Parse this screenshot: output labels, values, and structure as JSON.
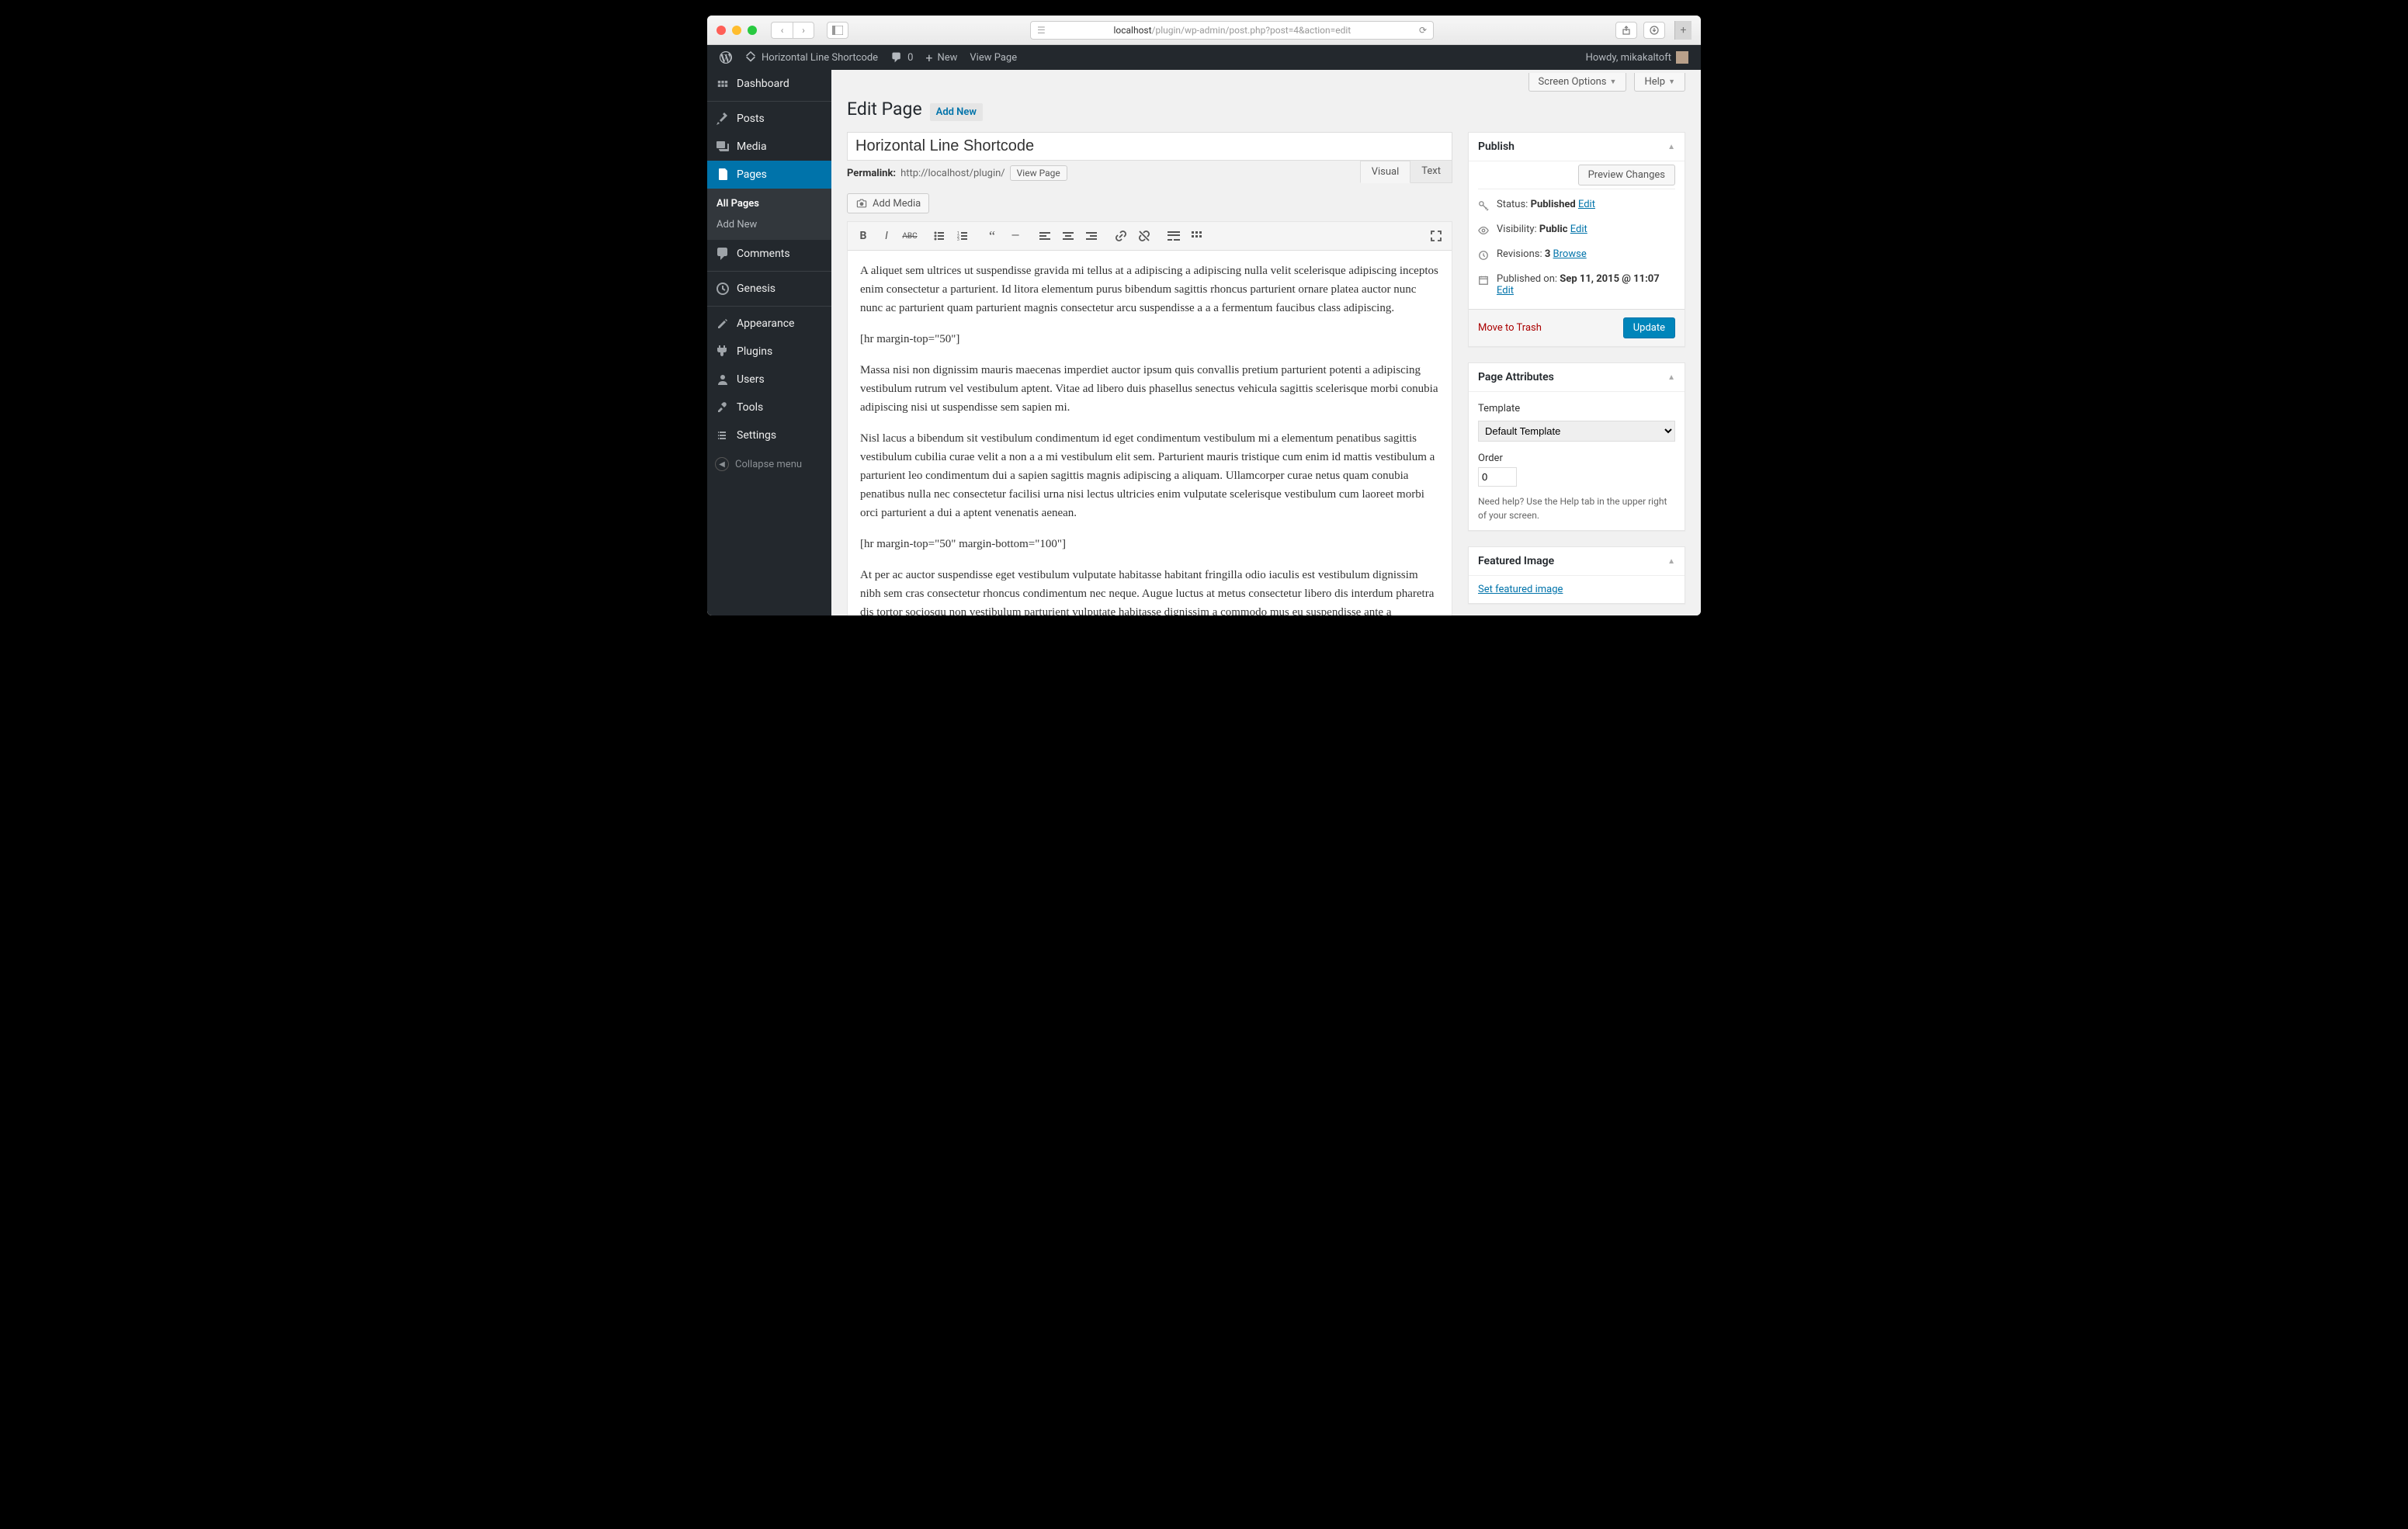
{
  "browser": {
    "url_host": "localhost",
    "url_path": "/plugin/wp-admin/post.php?post=4&action=edit"
  },
  "adminbar": {
    "site_title": "Horizontal Line Shortcode",
    "comments_count": "0",
    "new_label": "New",
    "view_page": "View Page",
    "howdy": "Howdy, mikakaltoft"
  },
  "sidebar": {
    "items": [
      {
        "label": "Dashboard"
      },
      {
        "label": "Posts"
      },
      {
        "label": "Media"
      },
      {
        "label": "Pages"
      },
      {
        "label": "Comments"
      },
      {
        "label": "Genesis"
      },
      {
        "label": "Appearance"
      },
      {
        "label": "Plugins"
      },
      {
        "label": "Users"
      },
      {
        "label": "Tools"
      },
      {
        "label": "Settings"
      }
    ],
    "pages_submenu": {
      "all": "All Pages",
      "add": "Add New"
    },
    "collapse": "Collapse menu"
  },
  "screen_options": {
    "screen": "Screen Options",
    "help": "Help"
  },
  "page": {
    "heading": "Edit Page",
    "add_new": "Add New",
    "title_value": "Horizontal Line Shortcode",
    "permalink_label": "Permalink:",
    "permalink_url": "http://localhost/plugin/",
    "view_page_btn": "View Page",
    "add_media": "Add Media",
    "tabs": {
      "visual": "Visual",
      "text": "Text"
    },
    "content": {
      "p1": "A aliquet sem ultrices ut suspendisse gravida mi tellus at a adipiscing a adipiscing nulla velit scelerisque adipiscing inceptos enim consectetur a parturient. Id litora elementum purus bibendum sagittis rhoncus parturient ornare platea auctor nunc nunc ac parturient quam parturient magnis consectetur arcu suspendisse a a a fermentum faucibus class adipiscing.",
      "sc1": "[hr margin-top=\"50\"]",
      "p2": "Massa nisi non dignissim mauris maecenas imperdiet auctor ipsum quis convallis pretium parturient potenti a adipiscing vestibulum rutrum vel vestibulum aptent. Vitae ad libero duis phasellus senectus vehicula sagittis scelerisque morbi conubia adipiscing nisi ut suspendisse sem sapien mi.",
      "p3": "Nisl lacus a bibendum sit vestibulum condimentum id eget condimentum vestibulum mi a elementum penatibus sagittis vestibulum cubilia curae velit a non a a mi vestibulum elit sem. Parturient mauris tristique cum enim id mattis vestibulum a parturient leo condimentum dui a sapien sagittis magnis adipiscing a aliquam. Ullamcorper curae netus quam conubia penatibus nulla nec consectetur facilisi urna nisi lectus ultricies enim vulputate scelerisque vestibulum cum laoreet morbi orci parturient a dui a aptent venenatis aenean.",
      "sc2": "[hr margin-top=\"50\" margin-bottom=\"100\"]",
      "p4": "At per ac auctor suspendisse eget vestibulum vulputate habitasse habitant fringilla odio iaculis est vestibulum dignissim nibh sem cras consectetur rhoncus condimentum nec neque. Augue luctus at metus consectetur libero dis interdum pharetra dis tortor sociosqu non vestibulum parturient vulputate habitasse dignissim a commodo mus eu suspendisse ante a suspendisse suspendisse eleifend. Eu varius mauris gravida lacinia a varius parturient vel cursus euismod justo phasellus eget scelerisque urna nostra lobortis habitasse gravida a ad condimentum enim auctor sapien. Amet fringilla euismod ligula erat urna vestibulum integer penatibus phasellus sodales ultricies congue sociis ut vestibulum erat praesent curabitur ac vestibulum vivamus nibh"
    }
  },
  "publish": {
    "title": "Publish",
    "preview": "Preview Changes",
    "status_label": "Status:",
    "status_value": "Published",
    "visibility_label": "Visibility:",
    "visibility_value": "Public",
    "revisions_label": "Revisions:",
    "revisions_value": "3",
    "browse": "Browse",
    "published_label": "Published on:",
    "published_value": "Sep 11, 2015 @ 11:07",
    "edit": "Edit",
    "trash": "Move to Trash",
    "update": "Update"
  },
  "attributes": {
    "title": "Page Attributes",
    "template_label": "Template",
    "template_value": "Default Template",
    "order_label": "Order",
    "order_value": "0",
    "help": "Need help? Use the Help tab in the upper right of your screen."
  },
  "featured": {
    "title": "Featured Image",
    "link": "Set featured image"
  }
}
